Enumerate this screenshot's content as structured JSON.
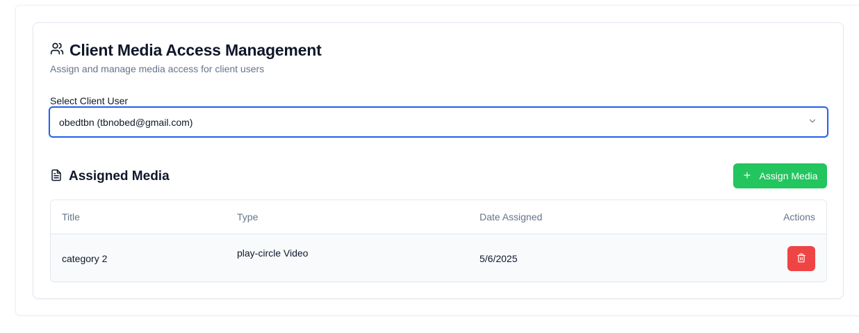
{
  "header": {
    "title": "Client Media Access Management",
    "subtitle": "Assign and manage media access for client users",
    "icon": "users-icon"
  },
  "client_select": {
    "label": "Select Client User",
    "value": "obedtbn (tbnobed@gmail.com)",
    "icon": "chevron-down-icon"
  },
  "assigned_media": {
    "title": "Assigned Media",
    "icon": "file-text-icon",
    "assign_button_label": "Assign Media",
    "assign_button_icon": "plus-icon",
    "columns": [
      "Title",
      "Type",
      "Date Assigned",
      "Actions"
    ],
    "rows": [
      {
        "title": "category 2",
        "type": "play-circle Video",
        "date": "5/6/2025",
        "action_icon": "trash-icon"
      }
    ]
  },
  "colors": {
    "accent_blue": "#2563eb",
    "assign_green": "#22c55e",
    "delete_red": "#ef4444",
    "muted_text": "#64748b"
  }
}
